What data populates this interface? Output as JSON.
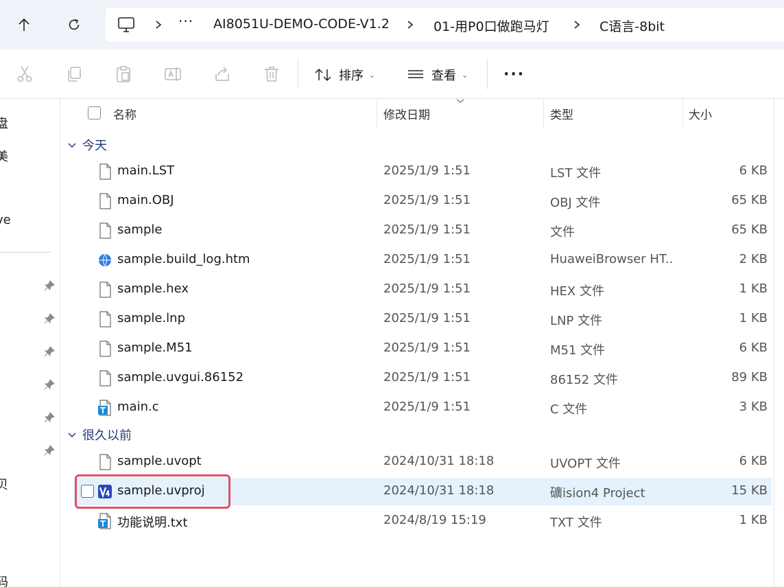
{
  "address": {
    "more": "···",
    "crumbs": [
      "AI8051U-DEMO-CODE-V1.2",
      "01-用P0口做跑马灯",
      "C语言-8bit"
    ]
  },
  "toolbar": {
    "sort_label": "排序",
    "view_label": "查看",
    "more_label": "···"
  },
  "leftnav": {
    "fragments": [
      "盘",
      "美",
      "ve",
      "贝",
      "码"
    ]
  },
  "columns": {
    "name": "名称",
    "date": "修改日期",
    "type": "类型",
    "size": "大小"
  },
  "groups": [
    {
      "label": "今天",
      "files": [
        {
          "name": "main.LST",
          "date": "2025/1/9 1:51",
          "type": "LST 文件",
          "size": "6 KB",
          "icon": "document-icon"
        },
        {
          "name": "main.OBJ",
          "date": "2025/1/9 1:51",
          "type": "OBJ 文件",
          "size": "65 KB",
          "icon": "document-icon"
        },
        {
          "name": "sample",
          "date": "2025/1/9 1:51",
          "type": "文件",
          "size": "65 KB",
          "icon": "document-icon"
        },
        {
          "name": "sample.build_log.htm",
          "date": "2025/1/9 1:51",
          "type": "HuaweiBrowser HT...",
          "size": "2 KB",
          "icon": "browser-icon"
        },
        {
          "name": "sample.hex",
          "date": "2025/1/9 1:51",
          "type": "HEX 文件",
          "size": "1 KB",
          "icon": "document-icon"
        },
        {
          "name": "sample.lnp",
          "date": "2025/1/9 1:51",
          "type": "LNP 文件",
          "size": "1 KB",
          "icon": "document-icon"
        },
        {
          "name": "sample.M51",
          "date": "2025/1/9 1:51",
          "type": "M51 文件",
          "size": "6 KB",
          "icon": "document-icon"
        },
        {
          "name": "sample.uvgui.86152",
          "date": "2025/1/9 1:51",
          "type": "86152 文件",
          "size": "89 KB",
          "icon": "document-icon"
        },
        {
          "name": "main.c",
          "date": "2025/1/9 1:51",
          "type": "C 文件",
          "size": "3 KB",
          "icon": "text-file-icon"
        }
      ]
    },
    {
      "label": "很久以前",
      "files": [
        {
          "name": "sample.uvopt",
          "date": "2024/10/31 18:18",
          "type": "UVOPT 文件",
          "size": "6 KB",
          "icon": "document-icon"
        },
        {
          "name": "sample.uvproj",
          "date": "2024/10/31 18:18",
          "type": "礦ision4 Project",
          "size": "15 KB",
          "icon": "keil-uvision-icon"
        },
        {
          "name": "功能说明.txt",
          "date": "2024/8/19 15:19",
          "type": "TXT 文件",
          "size": "1 KB",
          "icon": "text-file-icon"
        }
      ]
    }
  ],
  "colors": {
    "accent": "#1e3a7b",
    "selection": "#e5f1fb",
    "highlight": "#e05065",
    "titlebar": "#f0f3f9"
  }
}
